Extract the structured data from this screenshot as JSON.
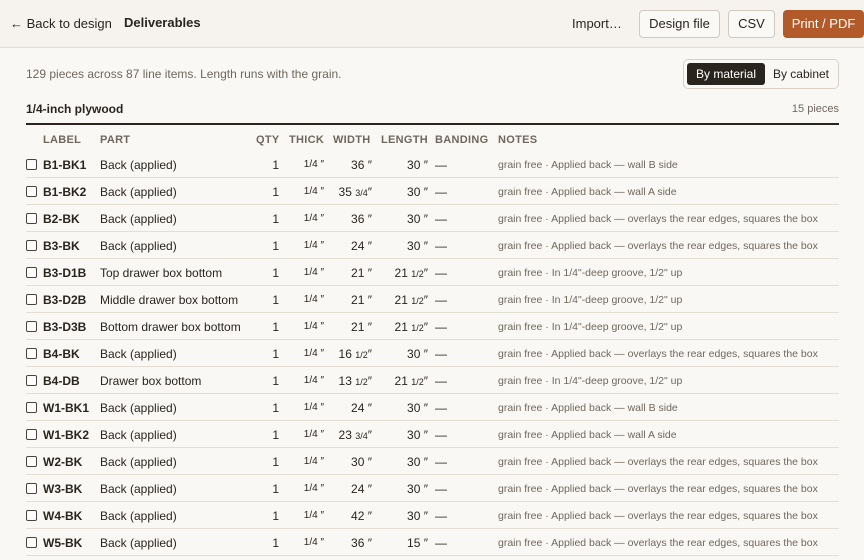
{
  "header": {
    "back_label": "← Back to design",
    "title": "Deliverables",
    "import_label": "Import…",
    "design_file_label": "Design file",
    "csv_label": "CSV",
    "print_label": "Print / PDF"
  },
  "summary": "129 pieces across 87 line items. Length runs with the grain.",
  "view_toggle": {
    "by_material": "By material",
    "by_cabinet": "By cabinet",
    "selected": "By material"
  },
  "group": {
    "title": "1/4-inch plywood",
    "count": "15 pieces"
  },
  "columns": {
    "label": "LABEL",
    "part": "PART",
    "qty": "QTY",
    "thick": "THICK",
    "width": "WIDTH",
    "length": "LENGTH",
    "banding": "BANDING",
    "notes": "NOTES"
  },
  "rows": [
    {
      "label": "B1-BK1",
      "part": "Back (applied)",
      "qty": "1",
      "thick": "1/4 ″",
      "width": "36",
      "width_frac": "",
      "length": "30",
      "length_frac": "",
      "banding": "—",
      "notes": "grain free · Applied back — wall B side"
    },
    {
      "label": "B1-BK2",
      "part": "Back (applied)",
      "qty": "1",
      "thick": "1/4 ″",
      "width": "35",
      "width_frac": "3/4",
      "length": "30",
      "length_frac": "",
      "banding": "—",
      "notes": "grain free · Applied back — wall A side"
    },
    {
      "label": "B2-BK",
      "part": "Back (applied)",
      "qty": "1",
      "thick": "1/4 ″",
      "width": "36",
      "width_frac": "",
      "length": "30",
      "length_frac": "",
      "banding": "—",
      "notes": "grain free · Applied back — overlays the rear edges, squares the box"
    },
    {
      "label": "B3-BK",
      "part": "Back (applied)",
      "qty": "1",
      "thick": "1/4 ″",
      "width": "24",
      "width_frac": "",
      "length": "30",
      "length_frac": "",
      "banding": "—",
      "notes": "grain free · Applied back — overlays the rear edges, squares the box"
    },
    {
      "label": "B3-D1B",
      "part": "Top drawer box bottom",
      "qty": "1",
      "thick": "1/4 ″",
      "width": "21",
      "width_frac": "",
      "length": "21",
      "length_frac": "1/2",
      "banding": "—",
      "notes": "grain free · In 1/4\"-deep groove, 1/2\" up"
    },
    {
      "label": "B3-D2B",
      "part": "Middle drawer box bottom",
      "qty": "1",
      "thick": "1/4 ″",
      "width": "21",
      "width_frac": "",
      "length": "21",
      "length_frac": "1/2",
      "banding": "—",
      "notes": "grain free · In 1/4\"-deep groove, 1/2\" up"
    },
    {
      "label": "B3-D3B",
      "part": "Bottom drawer box bottom",
      "qty": "1",
      "thick": "1/4 ″",
      "width": "21",
      "width_frac": "",
      "length": "21",
      "length_frac": "1/2",
      "banding": "—",
      "notes": "grain free · In 1/4\"-deep groove, 1/2\" up"
    },
    {
      "label": "B4-BK",
      "part": "Back (applied)",
      "qty": "1",
      "thick": "1/4 ″",
      "width": "16",
      "width_frac": "1/2",
      "length": "30",
      "length_frac": "",
      "banding": "—",
      "notes": "grain free · Applied back — overlays the rear edges, squares the box"
    },
    {
      "label": "B4-DB",
      "part": "Drawer box bottom",
      "qty": "1",
      "thick": "1/4 ″",
      "width": "13",
      "width_frac": "1/2",
      "length": "21",
      "length_frac": "1/2",
      "banding": "—",
      "notes": "grain free · In 1/4\"-deep groove, 1/2\" up"
    },
    {
      "label": "W1-BK1",
      "part": "Back (applied)",
      "qty": "1",
      "thick": "1/4 ″",
      "width": "24",
      "width_frac": "",
      "length": "30",
      "length_frac": "",
      "banding": "—",
      "notes": "grain free · Applied back — wall B side"
    },
    {
      "label": "W1-BK2",
      "part": "Back (applied)",
      "qty": "1",
      "thick": "1/4 ″",
      "width": "23",
      "width_frac": "3/4",
      "length": "30",
      "length_frac": "",
      "banding": "—",
      "notes": "grain free · Applied back — wall A side"
    },
    {
      "label": "W2-BK",
      "part": "Back (applied)",
      "qty": "1",
      "thick": "1/4 ″",
      "width": "30",
      "width_frac": "",
      "length": "30",
      "length_frac": "",
      "banding": "—",
      "notes": "grain free · Applied back — overlays the rear edges, squares the box"
    },
    {
      "label": "W3-BK",
      "part": "Back (applied)",
      "qty": "1",
      "thick": "1/4 ″",
      "width": "24",
      "width_frac": "",
      "length": "30",
      "length_frac": "",
      "banding": "—",
      "notes": "grain free · Applied back — overlays the rear edges, squares the box"
    },
    {
      "label": "W4-BK",
      "part": "Back (applied)",
      "qty": "1",
      "thick": "1/4 ″",
      "width": "42",
      "width_frac": "",
      "length": "30",
      "length_frac": "",
      "banding": "—",
      "notes": "grain free · Applied back — overlays the rear edges, squares the box"
    },
    {
      "label": "W5-BK",
      "part": "Back (applied)",
      "qty": "1",
      "thick": "1/4 ″",
      "width": "36",
      "width_frac": "",
      "length": "15",
      "length_frac": "",
      "banding": "—",
      "notes": "grain free · Applied back — overlays the rear edges, squares the box"
    }
  ],
  "colors": {
    "accent": "#b35a2a",
    "toggle_active": "#2a241f",
    "background": "#f6f3ee"
  }
}
